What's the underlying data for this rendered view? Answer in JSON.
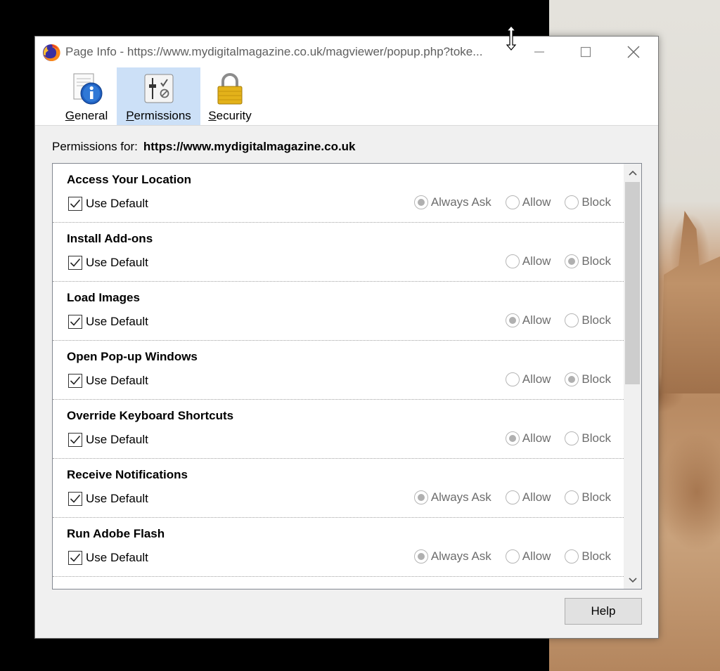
{
  "window": {
    "title": "Page Info - https://www.mydigitalmagazine.co.uk/magviewer/popup.php?toke...",
    "controls": {
      "minimize": "minimize-icon",
      "maximize": "maximize-icon",
      "close": "close-icon"
    }
  },
  "panes": [
    {
      "label_accel": "G",
      "label_rest": "eneral",
      "icon": "info-icon",
      "selected": false
    },
    {
      "label_accel": "P",
      "label_rest": "ermissions",
      "icon": "permissions-icon",
      "selected": true
    },
    {
      "label_accel": "S",
      "label_rest": "ecurity",
      "icon": "padlock-icon",
      "selected": false
    }
  ],
  "permissions_for": {
    "label": "Permissions for:",
    "host": "https://www.mydigitalmagazine.co.uk"
  },
  "use_default_label": "Use Default",
  "permissions": [
    {
      "title": "Access Your Location",
      "use_default": true,
      "options": [
        {
          "label": "Always Ask",
          "checked": true
        },
        {
          "label": "Allow",
          "checked": false
        },
        {
          "label": "Block",
          "checked": false
        }
      ]
    },
    {
      "title": "Install Add-ons",
      "use_default": true,
      "options": [
        {
          "label": "Allow",
          "checked": false
        },
        {
          "label": "Block",
          "checked": true
        }
      ]
    },
    {
      "title": "Load Images",
      "use_default": true,
      "options": [
        {
          "label": "Allow",
          "checked": true
        },
        {
          "label": "Block",
          "checked": false
        }
      ]
    },
    {
      "title": "Open Pop-up Windows",
      "use_default": true,
      "options": [
        {
          "label": "Allow",
          "checked": false
        },
        {
          "label": "Block",
          "checked": true
        }
      ]
    },
    {
      "title": "Override Keyboard Shortcuts",
      "use_default": true,
      "options": [
        {
          "label": "Allow",
          "checked": true
        },
        {
          "label": "Block",
          "checked": false
        }
      ]
    },
    {
      "title": "Receive Notifications",
      "use_default": true,
      "options": [
        {
          "label": "Always Ask",
          "checked": true
        },
        {
          "label": "Allow",
          "checked": false
        },
        {
          "label": "Block",
          "checked": false
        }
      ]
    },
    {
      "title": "Run Adobe Flash",
      "use_default": true,
      "options": [
        {
          "label": "Always Ask",
          "checked": true
        },
        {
          "label": "Allow",
          "checked": false
        },
        {
          "label": "Block",
          "checked": false
        }
      ]
    }
  ],
  "help_label": "Help",
  "colors": {
    "selected_pane": "#cce0f7",
    "dialog_bg": "#f0f0f0",
    "disabled_text": "#6d6d6d"
  }
}
